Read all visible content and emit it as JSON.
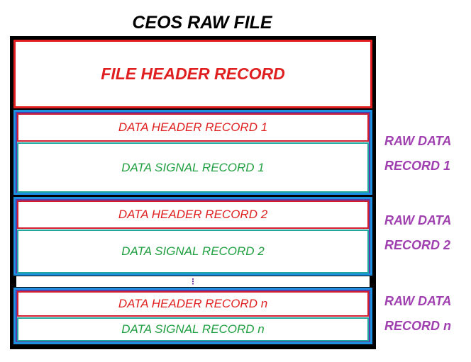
{
  "title": "CEOS RAW FILE",
  "file_header": "FILE HEADER RECORD",
  "groups": [
    {
      "header": "DATA HEADER RECORD 1",
      "signal": "DATA SIGNAL RECORD 1",
      "side_label_line1": "RAW DATA",
      "side_label_line2": "RECORD 1"
    },
    {
      "header": "DATA HEADER RECORD 2",
      "signal": "DATA SIGNAL RECORD 2",
      "side_label_line1": "RAW DATA",
      "side_label_line2": "RECORD 2"
    },
    {
      "header": "DATA HEADER RECORD n",
      "signal": "DATA SIGNAL RECORD n",
      "side_label_line1": "RAW DATA",
      "side_label_line2": "RECORD n"
    }
  ],
  "ellipsis": "⋮",
  "colors": {
    "file_header": "#e02020",
    "data_header_text": "#e02020",
    "data_signal_text": "#20a040",
    "side_label": "#a040b0",
    "group_border": "#1e90e0",
    "outer_frame": "#000000"
  }
}
